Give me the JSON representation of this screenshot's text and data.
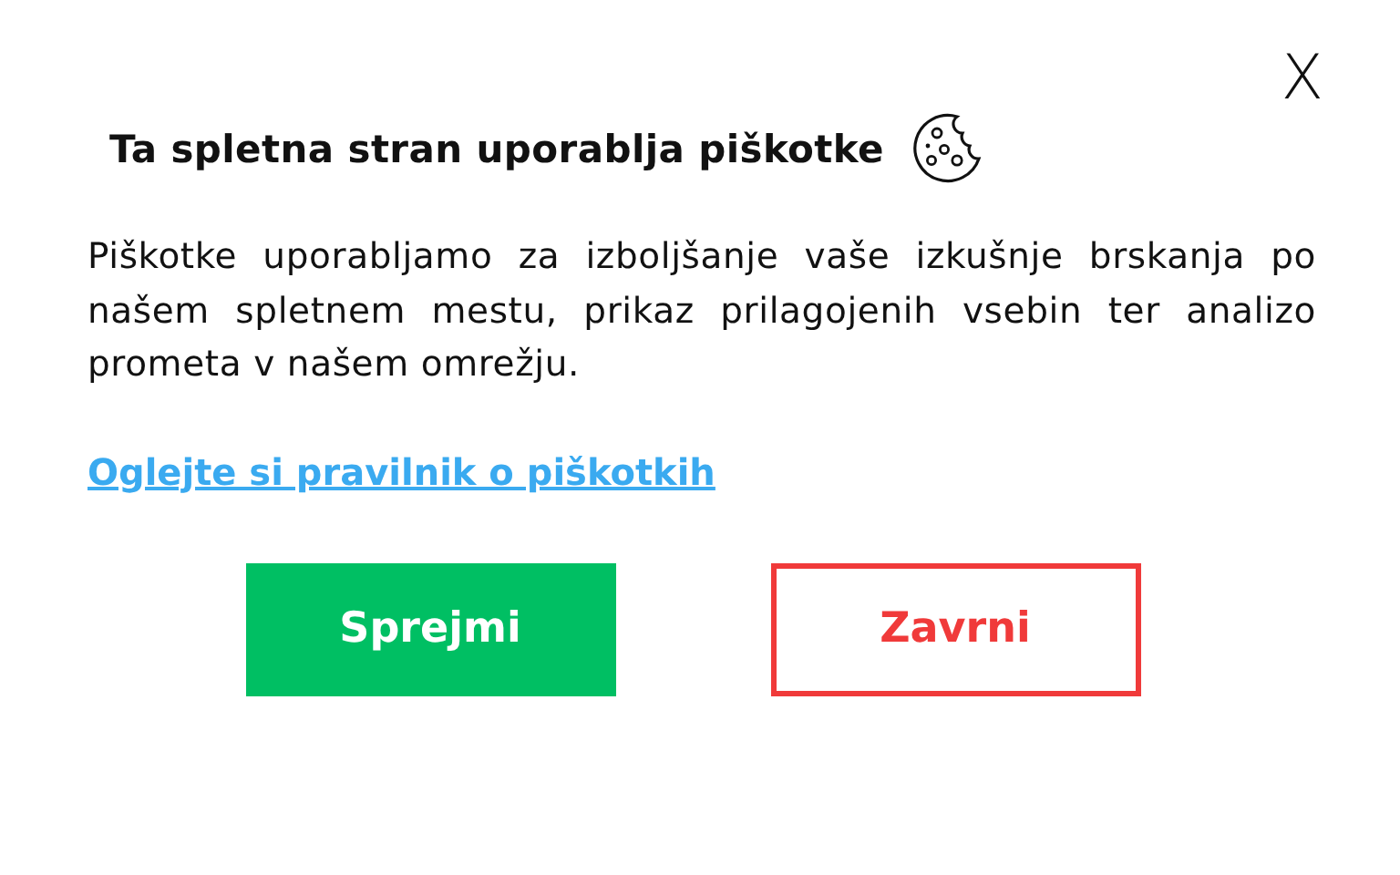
{
  "close_button": {
    "label": "X"
  },
  "title": "Ta spletna stran uporablja piškotke",
  "description": "Piškotke uporabljamo za izboljšanje vaše izkušnje brskanja po našem spletnem mestu, prikaz prilagojenih vsebin ter analizo prometa v našem omrežju.",
  "policy_link": "Oglejte si pravilnik o piškotkih",
  "buttons": [
    {
      "label": "Sprejmi",
      "kind": "primary"
    },
    {
      "label": "Zavrni",
      "kind": "outline"
    }
  ]
}
